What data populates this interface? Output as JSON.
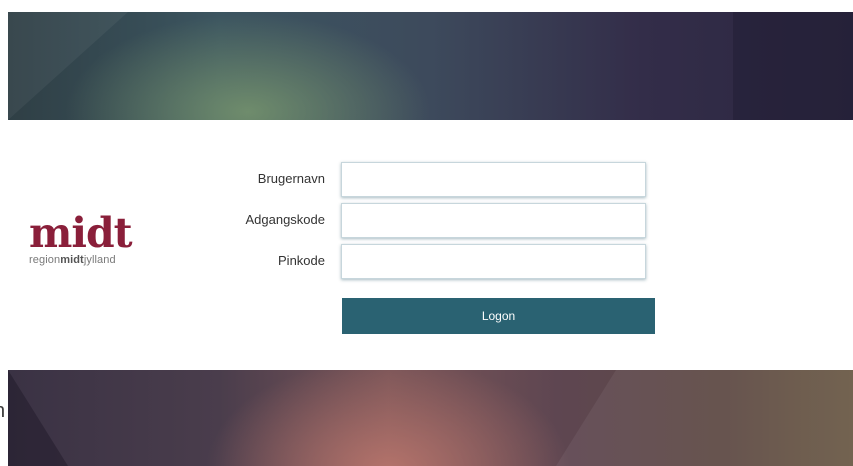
{
  "brand": {
    "logo_word": "midt",
    "logo_sub_prefix": "region",
    "logo_sub_bold": "midt",
    "logo_sub_suffix": "jylland",
    "color": "#8a1f3a"
  },
  "form": {
    "username": {
      "label": "Brugernavn",
      "value": "",
      "placeholder": ""
    },
    "password": {
      "label": "Adgangskode",
      "value": "",
      "placeholder": ""
    },
    "pin": {
      "label": "Pinkode",
      "value": "",
      "placeholder": ""
    },
    "submit_label": "Logon",
    "button_color": "#2a6272"
  },
  "edge_text": "n"
}
